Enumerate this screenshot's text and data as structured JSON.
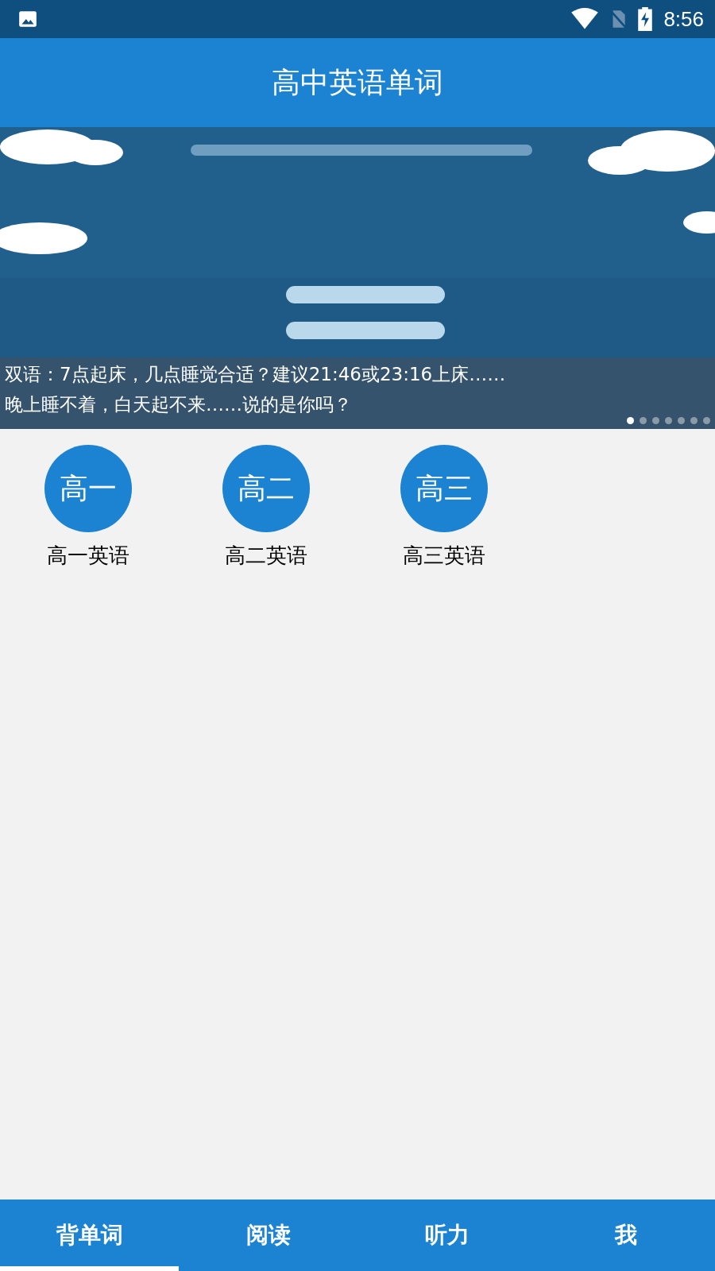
{
  "status_bar": {
    "time": "8:56"
  },
  "app_bar": {
    "title": "高中英语单词"
  },
  "banner": {
    "captions": [
      "双语：7点起床，几点睡觉合适？建议21:46或23:16上床……",
      "晚上睡不着，白天起不来……说的是你吗？"
    ],
    "dots": [
      {
        "selected": true
      },
      {
        "selected": false
      },
      {
        "selected": false
      },
      {
        "selected": false
      },
      {
        "selected": false
      },
      {
        "selected": false
      },
      {
        "selected": false
      }
    ]
  },
  "grades": [
    {
      "icon_text": "高一",
      "label": "高一英语"
    },
    {
      "icon_text": "高二",
      "label": "高二英语"
    },
    {
      "icon_text": "高三",
      "label": "高三英语"
    }
  ],
  "bottom_nav": [
    {
      "label": "背单词",
      "selected": true
    },
    {
      "label": "阅读",
      "selected": false
    },
    {
      "label": "听力",
      "selected": false
    },
    {
      "label": "我",
      "selected": false
    }
  ]
}
